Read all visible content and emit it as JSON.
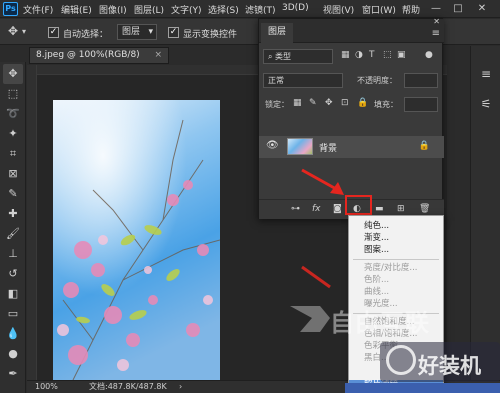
{
  "app": {
    "logo": "Ps"
  },
  "menubar": {
    "items": [
      "文件(F)",
      "编辑(E)",
      "图像(I)",
      "图层(L)",
      "文字(Y)",
      "选择(S)",
      "滤镜(T)",
      "3D(D)",
      "视图(V)",
      "窗口(W)",
      "帮助"
    ],
    "window_buttons": [
      "—",
      "□",
      "✕"
    ]
  },
  "options_bar": {
    "auto_select_label": "自动选择：",
    "auto_select_value": "图层",
    "show_transform_label": "显示变换控件",
    "auto_select_checked": true,
    "show_transform_checked": true
  },
  "document": {
    "tab_title": "8.jpeg @ 100%(RGB/8)",
    "tab_close": "×",
    "zoom": "100%",
    "doc_info": "文档:487.8K/487.8K",
    "status_arrow": "›"
  },
  "layers_panel": {
    "tab_label": "图层",
    "menu_icon": "≡",
    "close_icon": "✕",
    "filter_placeholder": "类型",
    "blend_mode": "正常",
    "opacity_label": "不透明度：",
    "lock_label": "锁定：",
    "fill_label": "填充：",
    "layer_name": "背景"
  },
  "adjustment_menu": {
    "items": [
      {
        "label": "纯色...",
        "enabled": true
      },
      {
        "label": "渐变...",
        "enabled": true
      },
      {
        "label": "图案...",
        "enabled": true
      },
      {
        "label": "亮度/对比度...",
        "enabled": false
      },
      {
        "label": "色阶...",
        "enabled": false
      },
      {
        "label": "曲线...",
        "enabled": false
      },
      {
        "label": "曝光度...",
        "enabled": false
      },
      {
        "label": "自然饱和度...",
        "enabled": false
      },
      {
        "label": "色相/饱和度...",
        "enabled": false
      },
      {
        "label": "色彩平衡...",
        "enabled": false
      },
      {
        "label": "黑白...",
        "enabled": false
      },
      {
        "label": "照片滤镜...",
        "enabled": true
      }
    ]
  },
  "watermarks": {
    "primary": "自由互联",
    "secondary": "好装机"
  },
  "colors": {
    "highlight_red": "#e5261f",
    "selection_blue": "#5a8fd6",
    "panel_bg": "#3a3a3a"
  },
  "icons": {
    "tools": [
      "move-icon",
      "marquee-icon",
      "lasso-icon",
      "magic-wand-icon",
      "crop-icon",
      "frame-icon",
      "eyedropper-icon",
      "healing-icon",
      "brush-icon",
      "stamp-icon",
      "history-brush-icon",
      "eraser-icon",
      "gradient-icon",
      "blur-icon",
      "dodge-icon",
      "pen-icon"
    ]
  }
}
